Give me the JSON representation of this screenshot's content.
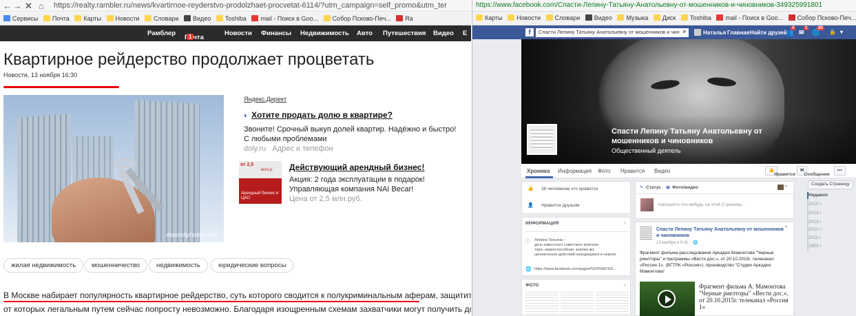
{
  "left": {
    "url": "https://realty.rambler.ru/news/kvartirnoe-reyderstvo-prodolzhaet-procvetat-6114/?utm_campaign=self_promo&utm_ter",
    "bookmarks": [
      "Сервисы",
      "Почта",
      "Карты",
      "Новости",
      "Словари",
      "Видео",
      "Toshiba",
      "mail - Поиск в Goo...",
      "Собор Псково-Печ...",
      "Ra"
    ],
    "nav": [
      "Рамблер",
      "Почта",
      "Новости",
      "Финансы",
      "Недвижимость",
      "Авто",
      "Путешествия",
      "Видео",
      "Е"
    ],
    "mail_count": "1",
    "title": "Квартирное рейдерство продолжает процветать",
    "date": "Новости, 13 ноября 16:30",
    "photo_caption": "depositphotos.com",
    "direct_label": "Яндекс.Директ",
    "ad1": {
      "title": "Хотите продать долю в квартире?",
      "line1": "Звоните! Срочный выкуп долей квартир. Надёжно и быстро!",
      "line2": "С любыми проблемами",
      "site": "doly.ru",
      "contact": "Адрес и телефон"
    },
    "ad2": {
      "title": "Действующий арендный бизнес!",
      "line1": "Акция: 2 года эксплуатации в подарок!",
      "line2": "Управляющая компания NAI Becar!",
      "price": "Цена от 2,5 млн.руб.",
      "thumb_price": "от 2,5",
      "thumb_unit": "млн.р.",
      "thumb_text": "Арендный бизнес в ЦАО"
    },
    "tags": [
      "жилая недвижимость",
      "мошенничество",
      "недвижимость",
      "юридические вопросы"
    ],
    "body1": "В Москве набирает популярность квартирное рейдерство, суть которого сводится к полукриминальным аферам, защититься",
    "body2": "от которых легальным путем сейчас попросту невозможно. Благодаря изощренным схемам захватчики могут получить долю"
  },
  "right": {
    "url": "https://www.facebook.com/Спасти-Лепину-Татьяну-Анатольевну-от-мошенников-и-чиновников-349325991801",
    "bookmarks": [
      "Карты",
      "Новости",
      "Словари",
      "Видео",
      "Музыка",
      "Диск",
      "Toshiba",
      "mail - Поиск в Goo...",
      "Собор Псково-Печ..."
    ],
    "search": "Спасти Лепину Татьяну Анатольевну от мошенников и чин",
    "user": "Наталья",
    "home": "Главная",
    "find_friends": "Найти друзей",
    "badges": [
      "4",
      "1",
      "20"
    ],
    "page_name1": "Спасти Лепину Татьяну Анатольевну от",
    "page_name2": "мошенников и чиновников",
    "page_category": "Общественный деятель",
    "tabs": [
      "Хроника",
      "Информация",
      "Фото",
      "Нравится",
      "Видео"
    ],
    "like_btn": "Нравится",
    "msg_btn": "Сообщение",
    "more_btn": "•••",
    "likes_text": "38 человекам это нравится",
    "invite_text": "Нравится друзьям",
    "info_header": "ИНФОРМАЦИЯ",
    "info_text": [
      "Лепина Татьяна –",
      "дочь известного советского компози-",
      "тора, недееспособная, жертва мо-",
      "шеннических действий находящаяся в неволе"
    ],
    "info_link": "https://www.facebook.com/pages/%D0%A1%D...",
    "photo_header": "ФОТО",
    "status_tab": "Статус",
    "photo_tab": "Фото/видео",
    "compose_placeholder": "Напишите что-нибудь на этой Странице...",
    "post_author1": "Спасти Лепину Татьяну Анатольевну от мошенников",
    "post_author2": "и чиновников",
    "post_time": "13 ноября в 0:31 ·",
    "post_text": [
      "Фрагмент фильма-расследования Аркадия Мамонтова \"Черные",
      "риелторы\" и программы «Вести дос.», от 20.10.2015г. телеканал",
      "«Россия 1», (ВГТРК «Россия»), производство \"Студия Аркадия",
      "Мамонтова\""
    ],
    "video_title": [
      "Фрагмент фильма А. Мамонтова",
      "\"Черные риелторы\" «Вести дос.»,",
      "от 20.10.2015г. телеканал «Россия",
      "1»"
    ],
    "create_page": "Создать Страницу",
    "timeline_years": [
      "Недавно",
      "2015 г.",
      "2014 г.",
      "2013 г.",
      "2012 г.",
      "2011 г.",
      "1953 г."
    ]
  }
}
